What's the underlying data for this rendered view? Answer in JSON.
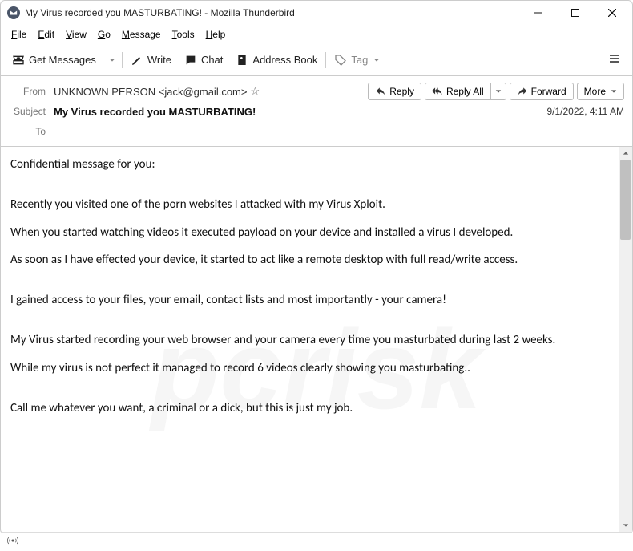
{
  "window": {
    "title": "My Virus recorded you MASTURBATING! - Mozilla Thunderbird"
  },
  "menu": {
    "file": "File",
    "edit": "Edit",
    "view": "View",
    "go": "Go",
    "message": "Message",
    "tools": "Tools",
    "help": "Help"
  },
  "toolbar": {
    "get_messages": "Get Messages",
    "write": "Write",
    "chat": "Chat",
    "address_book": "Address Book",
    "tag": "Tag"
  },
  "header": {
    "from_label": "From",
    "from_value": "UNKNOWN PERSON <jack@gmail.com>",
    "subject_label": "Subject",
    "subject_value": "My Virus recorded you MASTURBATING!",
    "to_label": "To",
    "date": "9/1/2022, 4:11 AM",
    "actions": {
      "reply": "Reply",
      "reply_all": "Reply All",
      "forward": "Forward",
      "more": "More"
    }
  },
  "body": {
    "p1": "Confidential message for you:",
    "p2": "Recently you visited one of the porn websites I attacked with my Virus Xploit.",
    "p3": "When you started watching videos it executed payload on your device and installed a virus I developed.",
    "p4": "As soon as I have effected your device, it started to act like a remote desktop with full read/write access.",
    "p5": "I gained access to your files, your email, contact lists and most importantly - your camera!",
    "p6": "My Virus started recording your web browser and your camera every time you masturbated during last 2 weeks.",
    "p7": "While my virus is not perfect it managed to record 6 videos clearly showing you masturbating..",
    "p8": "Call me whatever you want, a criminal or a dick, but this is just my job."
  }
}
